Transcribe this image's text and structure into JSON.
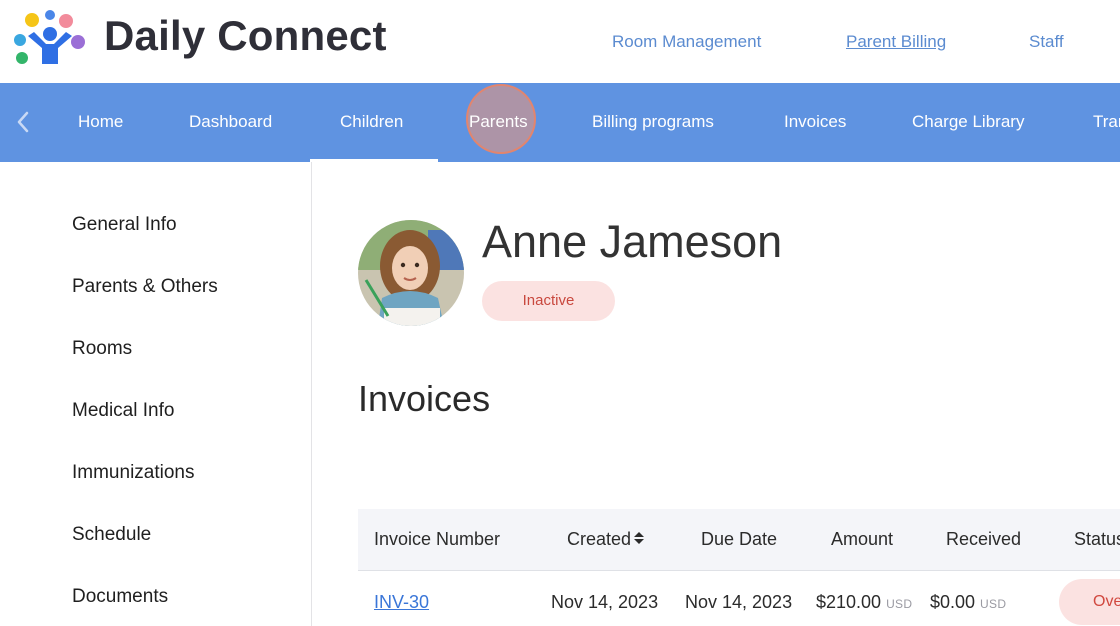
{
  "header": {
    "brand": "Daily Connect",
    "links": [
      {
        "label": "Room Management"
      },
      {
        "label": "Parent Billing",
        "active": true
      },
      {
        "label": "Staff"
      }
    ]
  },
  "nav": {
    "items": [
      {
        "label": "Home"
      },
      {
        "label": "Dashboard"
      },
      {
        "label": "Children",
        "selected": true
      },
      {
        "label": "Parents"
      },
      {
        "label": "Billing programs"
      },
      {
        "label": "Invoices"
      },
      {
        "label": "Charge Library"
      },
      {
        "label": "Tran"
      }
    ]
  },
  "sidebar": {
    "items": [
      {
        "label": "General Info"
      },
      {
        "label": "Parents & Others"
      },
      {
        "label": "Rooms"
      },
      {
        "label": "Medical Info"
      },
      {
        "label": "Immunizations"
      },
      {
        "label": "Schedule"
      },
      {
        "label": "Documents"
      }
    ]
  },
  "child": {
    "name": "Anne Jameson",
    "status": "Inactive"
  },
  "invoices": {
    "title": "Invoices",
    "columns": [
      "Invoice Number",
      "Created",
      "Due Date",
      "Amount",
      "Received",
      "Status"
    ],
    "rows": [
      {
        "number": "INV-30",
        "created": "Nov 14, 2023",
        "due": "Nov 14, 2023",
        "amount": "$210.00",
        "amount_unit": "USD",
        "received": "$0.00",
        "received_unit": "USD",
        "status": "Ove"
      }
    ]
  },
  "colors": {
    "nav_bg": "#5f93e1",
    "link": "#5b8bd0",
    "badge_bg": "#fbe2e1",
    "badge_text": "#c9483e"
  }
}
